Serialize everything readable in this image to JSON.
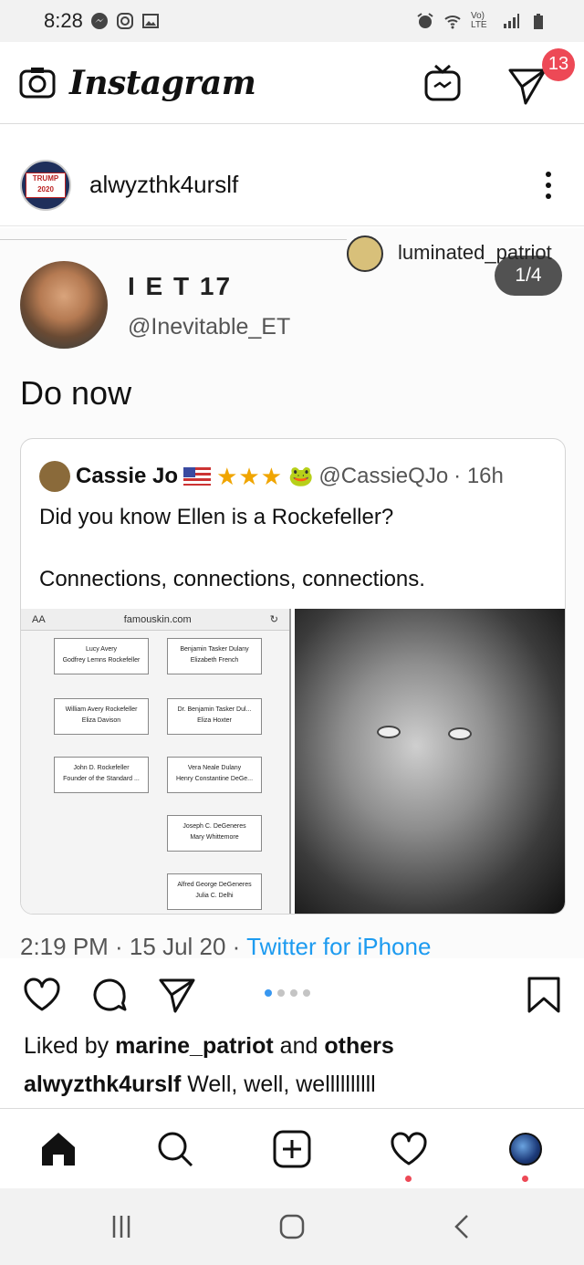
{
  "status_bar": {
    "time": "8:28",
    "network": "Vo) LTE"
  },
  "app_bar": {
    "title": "Instagram",
    "dm_badge": "13"
  },
  "post": {
    "username": "alwyzthk4urslf",
    "avatar_text": "TRUMP 2020",
    "pager": "1/4",
    "reposter": "luminated_patriot",
    "tweet": {
      "name": "I E T 17",
      "handle": "@Inevitable_ET",
      "text": "Do now",
      "quote": {
        "name": "Cassie Jo",
        "stars": "★★★",
        "handle": "@CassieQJo",
        "age": "· 16h",
        "line1": "Did you know Ellen is a Rockefeller?",
        "line2": "Connections, connections, connections.",
        "browser_aa": "AA",
        "browser_url": "famouskin.com",
        "tree": [
          "Lucy Avery\nGodfrey Lemns Rockefeller",
          "Benjamin Tasker Dulany\nElizabeth French",
          "William Avery Rockefeller\nEliza Davison",
          "Dr. Benjamin Tasker Dul...\nEliza Hoxter",
          "John D. Rockefeller\nFounder of the Standard ...",
          "Vera Neale Dulany\nHenry Constantine DeGe...",
          "Joseph C. DeGeneres\nMary Whittemore",
          "Alfred George DeGeneres\nJulia C. Delhi"
        ]
      },
      "meta_time": "2:19 PM · 15 Jul 20 · ",
      "meta_app": "Twitter for iPhone"
    },
    "likes_prefix": "Liked by ",
    "likes_user": "marine_patriot",
    "likes_mid": " and ",
    "likes_others": "others",
    "caption_user": "alwyzthk4urslf",
    "caption_text": " Well, well, wellllllllll"
  }
}
